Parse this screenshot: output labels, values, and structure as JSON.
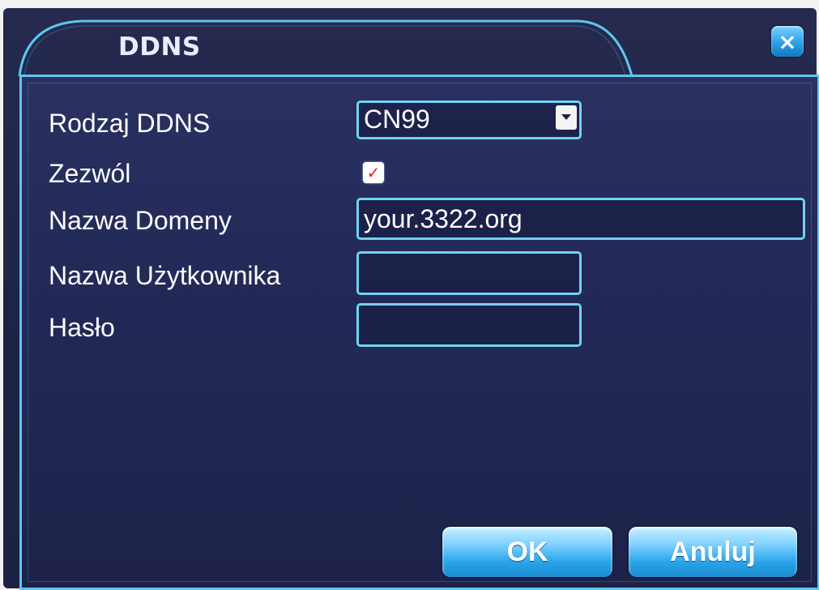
{
  "dialog": {
    "title": "DDNS",
    "close_symbol": "×"
  },
  "form": {
    "ddns_type_label": "Rodzaj DDNS",
    "ddns_type_value": "CN99",
    "enable_label": "Zezwól",
    "enable_checked": true,
    "domain_label": "Nazwa Domeny",
    "domain_value": "your.3322.org",
    "username_label": "Nazwa Użytkownika",
    "username_value": "",
    "password_label": "Hasło",
    "password_value": ""
  },
  "buttons": {
    "ok_label": "OK",
    "cancel_label": "Anuluj"
  },
  "icons": {
    "close": "close-icon",
    "dropdown": "chevron-down-icon",
    "check": "checkmark-icon"
  },
  "colors": {
    "background": "#1f2448",
    "border": "#5cc7ee",
    "button": "#2aa5ea",
    "checkmark": "#e1261c"
  }
}
